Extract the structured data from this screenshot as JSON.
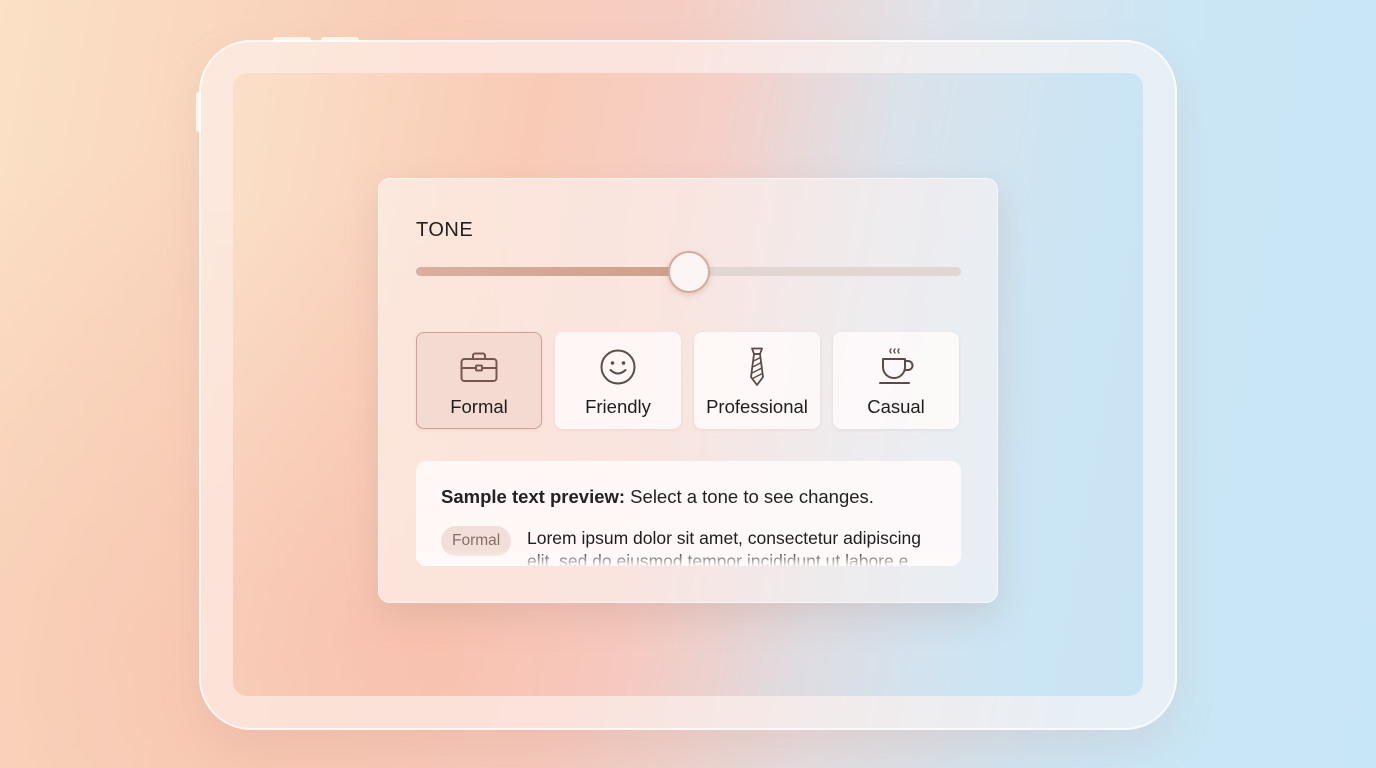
{
  "tone_panel": {
    "title": "TONE",
    "slider": {
      "value_percent": 50
    },
    "options": [
      {
        "label": "Formal",
        "icon": "briefcase-icon",
        "selected": true
      },
      {
        "label": "Friendly",
        "icon": "smiley-face-icon",
        "selected": false
      },
      {
        "label": "Professional",
        "icon": "necktie-icon",
        "selected": false
      },
      {
        "label": "Casual",
        "icon": "coffee-cup-icon",
        "selected": false
      }
    ],
    "preview": {
      "heading_bold": "Sample text preview:",
      "heading_rest": " Select a tone to see changes.",
      "badge": "Formal",
      "body": "Lorem ipsum dolor sit amet, consectetur adipiscing elit, sed do eiusmod tempor incididunt ut labore e"
    }
  },
  "colors": {
    "accent": "#d4a593",
    "selected_bg": "#f2d7cd",
    "badge_bg": "#f3dfd9"
  }
}
